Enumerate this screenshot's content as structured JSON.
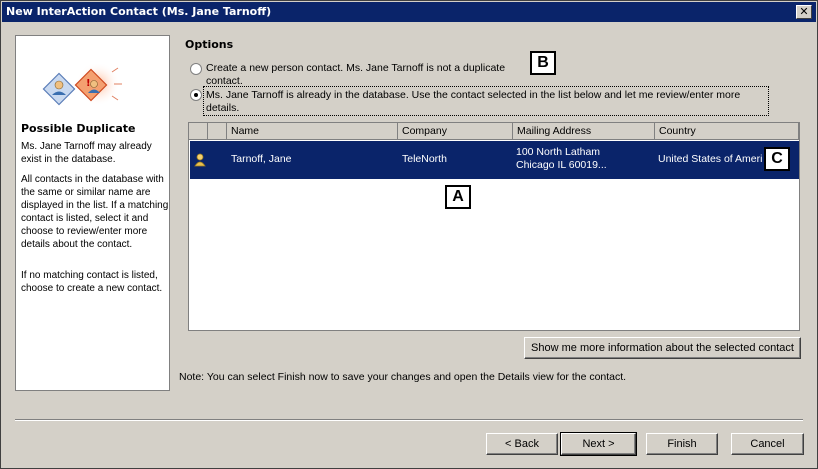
{
  "window": {
    "title": "New InterAction Contact (Ms. Jane Tarnoff)",
    "close_label": "✕"
  },
  "sidebar": {
    "title": "Possible Duplicate",
    "para1": "Ms. Jane Tarnoff may already exist in the database.",
    "para2": "All contacts in the database with the same or similar name are displayed in the list.  If a matching contact is listed, select it and choose to review/enter more details about the contact.",
    "para3": "If no matching contact is listed, choose to create a new contact.",
    "art_icons": [
      "contact-card-icon",
      "warning-contact-icon"
    ]
  },
  "options": {
    "label": "Options",
    "radio1": "Create a new person contact. Ms. Jane Tarnoff is not a duplicate contact.",
    "radio2": "Ms. Jane Tarnoff is already in the database. Use the contact selected in the list below and let me review/enter more details.",
    "selected": 2
  },
  "table": {
    "columns": [
      "",
      "Name",
      "Company",
      "Mailing Address",
      "Country"
    ],
    "rows": [
      {
        "icon": "person-icon",
        "name": "Tarnoff, Jane",
        "company": "TeleNorth",
        "address_line1": "100 North Latham",
        "address_line2": "Chicago IL 60019...",
        "country": "United States of Ameri",
        "selected": true
      }
    ]
  },
  "more_info_button": "Show me more information about the selected contact",
  "note": "Note: You can select Finish now to save your changes and open the Details view for the contact.",
  "callouts": {
    "a": "A",
    "b": "B",
    "c": "C"
  },
  "footer": {
    "back": "< Back",
    "next": "Next >",
    "finish": "Finish",
    "cancel": "Cancel"
  },
  "colors": {
    "selection": "#0a246a",
    "dialog_bg": "#d4d0c8"
  }
}
